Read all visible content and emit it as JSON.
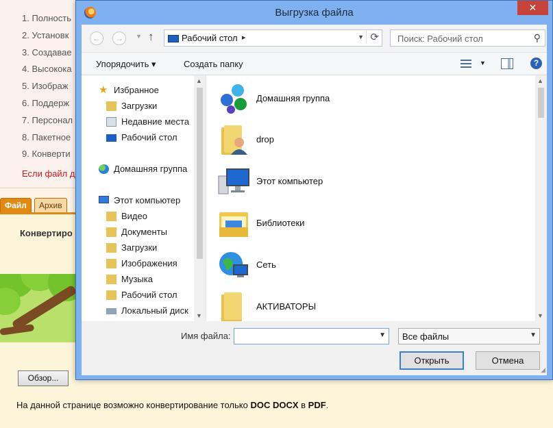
{
  "background": {
    "list": [
      "1. Полность",
      "2. Установк",
      "3. Создавае",
      "4. Высокока",
      "5. Изображ",
      "6. Поддерж",
      "7. Персонал",
      "8. Пакетное",
      "9. Конверти"
    ],
    "red_text": "Если файл д",
    "tabs": [
      {
        "label": "Файл"
      },
      {
        "label": "Архив"
      }
    ],
    "heading": "Конвертиро",
    "browse_label": "Обзор...",
    "note_prefix": "На данной странице возможно конвертирование только ",
    "note_formats": "DOC DOCX",
    "note_middle": " в ",
    "note_target": "PDF",
    "note_suffix": "."
  },
  "dialog": {
    "title": "Выгрузка файла",
    "close_label": "✕",
    "address": {
      "location": "Рабочий стол",
      "separator": "▸"
    },
    "search": {
      "placeholder": "Поиск: Рабочий стол"
    },
    "toolbar": {
      "organize": "Упорядочить ▾",
      "new_folder": "Создать папку",
      "help": "?"
    },
    "nav": {
      "favorites": "Избранное",
      "fav_items": [
        "Загрузки",
        "Недавние места",
        "Рабочий стол"
      ],
      "homegroup": "Домашняя группа",
      "computer": "Этот компьютер",
      "computer_items": [
        "Видео",
        "Документы",
        "Загрузки",
        "Изображения",
        "Музыка",
        "Рабочий стол",
        "Локальный диск"
      ]
    },
    "files": [
      {
        "name": "Домашняя группа",
        "icon": "homegroup-icon"
      },
      {
        "name": "drop",
        "icon": "user-folder-icon"
      },
      {
        "name": "Этот компьютер",
        "icon": "computer-icon"
      },
      {
        "name": "Библиотеки",
        "icon": "libraries-icon"
      },
      {
        "name": "Сеть",
        "icon": "network-icon"
      },
      {
        "name": "АКТИВАТОРЫ",
        "icon": "folder-icon"
      }
    ],
    "filename_label": "Имя файла:",
    "filename_value": "",
    "filetype": "Все файлы",
    "open_label": "Открыть",
    "cancel_label": "Отмена"
  }
}
